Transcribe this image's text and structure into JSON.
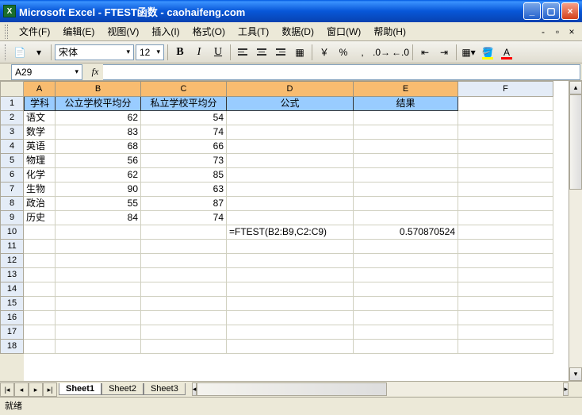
{
  "window": {
    "title": "Microsoft Excel - FTEST函数 - caohaifeng.com"
  },
  "menu": {
    "file": "文件(F)",
    "edit": "编辑(E)",
    "view": "视图(V)",
    "insert": "插入(I)",
    "format": "格式(O)",
    "tools": "工具(T)",
    "data": "数据(D)",
    "window": "窗口(W)",
    "help": "帮助(H)"
  },
  "toolbar": {
    "font": "宋体",
    "size": "12",
    "bold": "B",
    "italic": "I",
    "underline": "U",
    "currency": "￥",
    "percent": "%",
    "comma": ",",
    "font_color_letter": "A"
  },
  "namebox": "A29",
  "columns": [
    "A",
    "B",
    "C",
    "D",
    "E",
    "F"
  ],
  "headers": {
    "A": "学科",
    "B": "公立学校平均分",
    "C": "私立学校平均分",
    "D": "公式",
    "E": "结果"
  },
  "rows": [
    {
      "n": "2",
      "A": "语文",
      "B": "62",
      "C": "54"
    },
    {
      "n": "3",
      "A": "数学",
      "B": "83",
      "C": "74"
    },
    {
      "n": "4",
      "A": "英语",
      "B": "68",
      "C": "66"
    },
    {
      "n": "5",
      "A": "物理",
      "B": "56",
      "C": "73"
    },
    {
      "n": "6",
      "A": "化学",
      "B": "62",
      "C": "85"
    },
    {
      "n": "7",
      "A": "生物",
      "B": "90",
      "C": "63"
    },
    {
      "n": "8",
      "A": "政治",
      "B": "55",
      "C": "87"
    },
    {
      "n": "9",
      "A": "历史",
      "B": "84",
      "C": "74"
    }
  ],
  "formula_row": {
    "n": "10",
    "D": "=FTEST(B2:B9,C2:C9)",
    "E": "0.570870524"
  },
  "empty_rows": [
    "11",
    "12",
    "13",
    "14",
    "15",
    "16",
    "17",
    "18"
  ],
  "sheets": {
    "s1": "Sheet1",
    "s2": "Sheet2",
    "s3": "Sheet3"
  },
  "status": "就绪",
  "chart_data": {
    "type": "table",
    "title": "FTEST函数",
    "columns": [
      "学科",
      "公立学校平均分",
      "私立学校平均分"
    ],
    "data": [
      [
        "语文",
        62,
        54
      ],
      [
        "数学",
        83,
        74
      ],
      [
        "英语",
        68,
        66
      ],
      [
        "物理",
        56,
        73
      ],
      [
        "化学",
        62,
        85
      ],
      [
        "生物",
        90,
        63
      ],
      [
        "政治",
        55,
        87
      ],
      [
        "历史",
        84,
        74
      ]
    ],
    "formula": "=FTEST(B2:B9,C2:C9)",
    "result": 0.570870524
  }
}
